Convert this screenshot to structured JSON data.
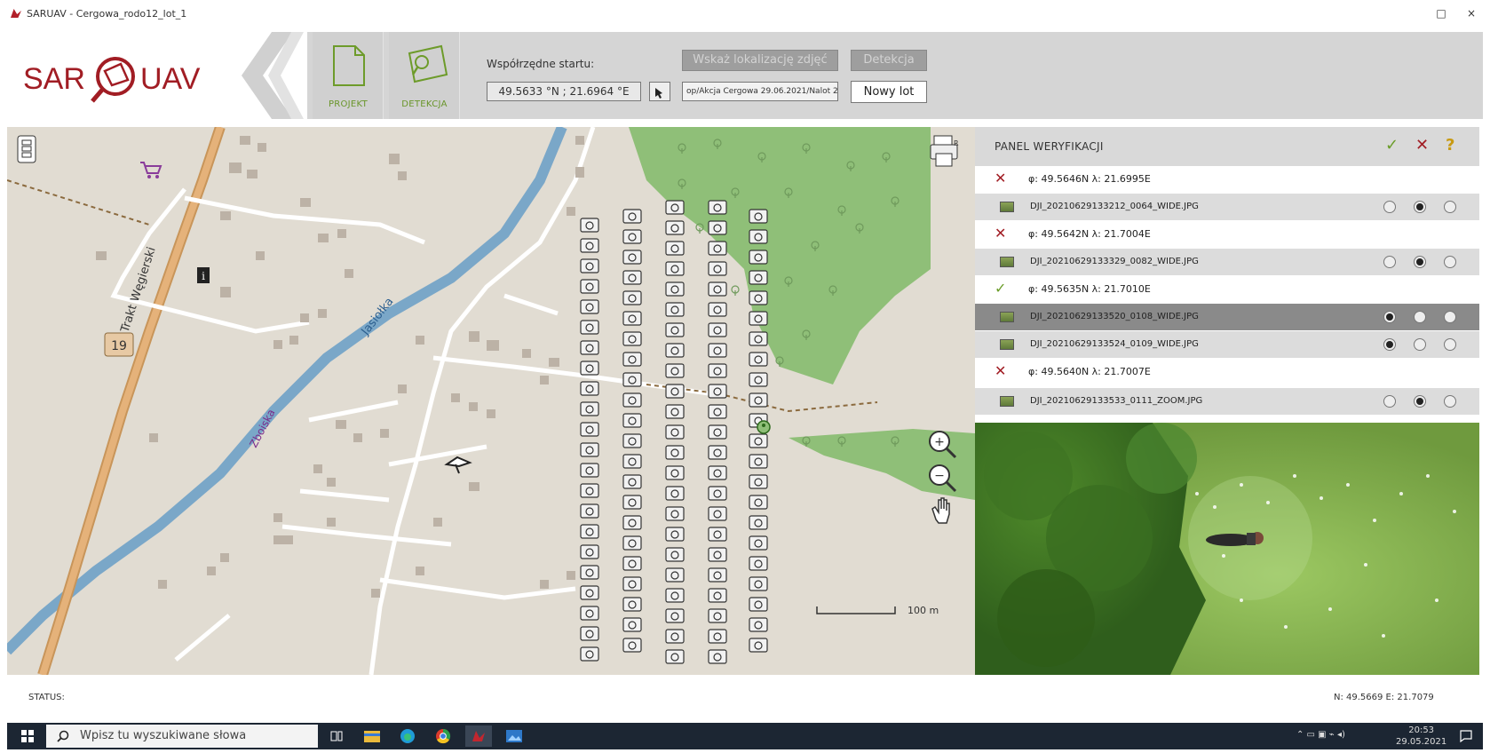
{
  "window": {
    "title": "SARUAV - Cergowa_rodo12_lot_1",
    "controls": [
      "□",
      "×"
    ]
  },
  "brand": {
    "left": "SAR",
    "right": "UAV",
    "color": "#a11d24"
  },
  "toolbar": {
    "projekt_label": "PROJEKT",
    "detekcja_label": "DETEKCJA",
    "coord_label": "Współrzędne startu:",
    "coord_value": "49.5633 °N ;  21.6964 °E",
    "show_locations_label": "Wskaż lokalizację zdjęć",
    "detection_label": "Detekcja",
    "path_value": "op/Akcja Cergowa 29.06.2021/Nalot 2",
    "new_flight_label": "Nowy lot",
    "accent": "#6d9b2a"
  },
  "map": {
    "labels": {
      "road_name": "Trakt Węgierski",
      "road_number": "19",
      "river": "Jasiołka",
      "street": "Zboiska",
      "scale": "100 m"
    },
    "icons": [
      "layers-icon",
      "print-icon",
      "zoom-in-icon",
      "zoom-out-icon",
      "pan-hand-icon",
      "shopping-cart-icon",
      "information-icon",
      "drone-icon"
    ],
    "colors": {
      "land": "#e1dcd2",
      "forest": "#8fbf78",
      "river": "#7aa7c8",
      "trunk": "#d29f64"
    }
  },
  "panel": {
    "title": "PANEL WERYFIKACJI",
    "header_icons": {
      "confirm": "✓",
      "reject": "✕",
      "unknown": "?"
    },
    "rows": [
      {
        "type": "loc",
        "status": "rejected",
        "mark": "✕",
        "text": "φ: 49.5646N  λ: 21.6995E"
      },
      {
        "type": "img",
        "text": "DJI_20210629133212_0064_WIDE.JPG",
        "choice": 1,
        "selected": false
      },
      {
        "type": "loc",
        "status": "rejected",
        "mark": "✕",
        "text": "φ: 49.5642N  λ: 21.7004E"
      },
      {
        "type": "img",
        "text": "DJI_20210629133329_0082_WIDE.JPG",
        "choice": 1,
        "selected": false
      },
      {
        "type": "loc",
        "status": "confirmed",
        "mark": "✓",
        "text": "φ: 49.5635N  λ: 21.7010E"
      },
      {
        "type": "img",
        "text": "DJI_20210629133520_0108_WIDE.JPG",
        "choice": 0,
        "selected": true
      },
      {
        "type": "img",
        "text": "DJI_20210629133524_0109_WIDE.JPG",
        "choice": 0,
        "selected": false
      },
      {
        "type": "loc",
        "status": "rejected",
        "mark": "✕",
        "text": "φ: 49.5640N  λ: 21.7007E"
      },
      {
        "type": "img",
        "text": "DJI_20210629133533_0111_ZOOM.JPG",
        "choice": 1,
        "selected": false
      }
    ]
  },
  "status": {
    "label": "STATUS:",
    "coords": "N: 49.5669 E: 21.7079"
  },
  "taskbar": {
    "search_placeholder": "Wpisz tu wyszukiwane słowa",
    "time": "20:53",
    "date": "29.05.2021"
  }
}
